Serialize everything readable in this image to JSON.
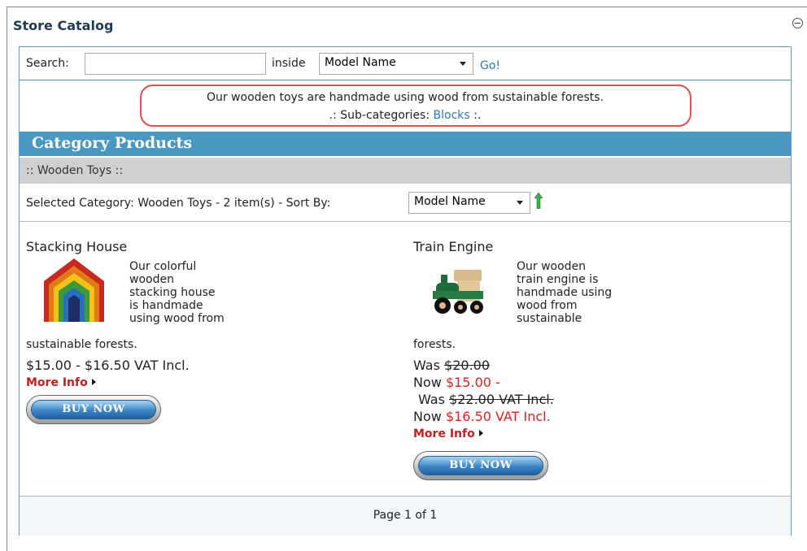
{
  "header": {
    "title": "Store Catalog"
  },
  "search": {
    "label": "Search:",
    "value": "",
    "inside_label": "inside",
    "field_selected": "Model Name",
    "go_label": "Go!"
  },
  "description": {
    "text": "Our wooden toys are handmade using wood from sustainable forests.",
    "subcat_prefix": ".: Sub-categories: ",
    "subcat_link": "Blocks",
    "subcat_suffix": " :."
  },
  "category_bar": {
    "title": "Category Products"
  },
  "breadcrumb": {
    "text": ":: Wooden Toys ::"
  },
  "sort": {
    "label": "Selected Category: Wooden Toys - 2 item(s) - Sort By:",
    "selected": "Model Name"
  },
  "products": [
    {
      "title": "Stacking House",
      "desc_lines": [
        "Our colorful",
        "wooden",
        "stacking house",
        "is handmade",
        "using wood from",
        "sustainable forests."
      ],
      "price": "$15.00 - $16.50 VAT Incl.",
      "more_info": "More Info",
      "buy_label": "BUY NOW"
    },
    {
      "title": "Train Engine",
      "desc_lines": [
        "Our wooden",
        "train engine is",
        "handmade using",
        "wood from",
        "sustainable",
        "forests."
      ],
      "was_label": "Was ",
      "was_price": "$20.00",
      "now_label": "Now ",
      "now_price": "$15.00",
      "dash": " -",
      "was_label2": "Was ",
      "was_price2": "$22.00 VAT Incl.",
      "now_label2": "Now ",
      "now_price2": "$16.50 VAT Incl.",
      "more_info": "More Info",
      "buy_label": "BUY NOW"
    }
  ],
  "pagination": {
    "text": "Page 1 of 1"
  }
}
